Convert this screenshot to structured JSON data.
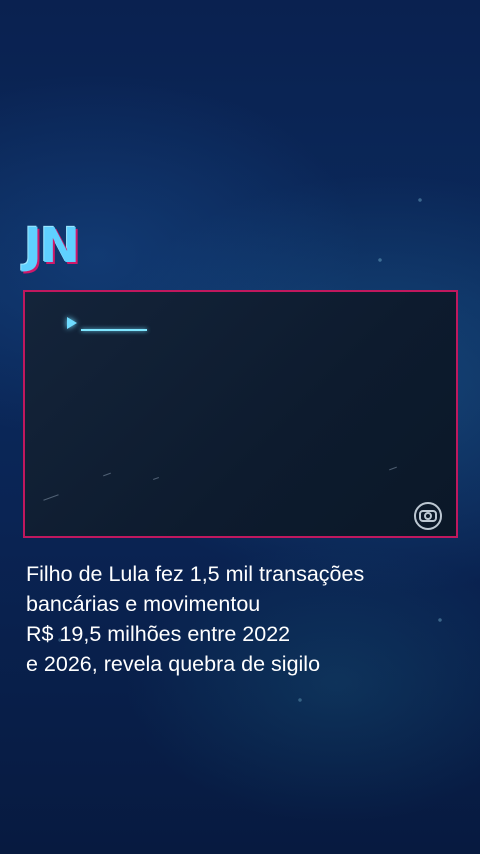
{
  "brand": {
    "logo_text": "JN",
    "accent_color": "#5fd0ff",
    "frame_color": "#c0185e"
  },
  "video": {
    "play_icon": "play-icon",
    "watermark_icon": "globo-logo-icon"
  },
  "headline": {
    "lines": [
      "Filho de Lula fez 1,5 mil transações",
      "bancárias e movimentou",
      "R$ 19,5 milhões entre 2022",
      "e 2026, revela quebra de sigilo"
    ]
  }
}
